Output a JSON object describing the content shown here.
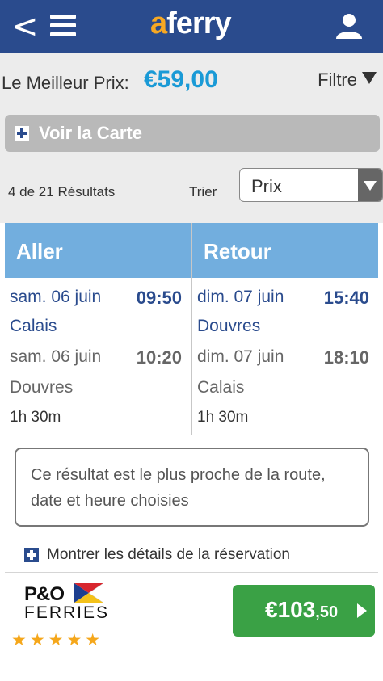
{
  "header": {
    "logo_a": "a",
    "logo_rest": "ferry",
    "back_icon": "chevron-left-icon",
    "menu_icon": "hamburger-icon",
    "user_icon": "user-icon"
  },
  "best_price": {
    "label": "Le Meilleur Prix:",
    "price": "€59,00"
  },
  "filter": {
    "label": "Filtre"
  },
  "map_toggle": {
    "label": "Voir la Carte"
  },
  "results": {
    "count": "4 de 21 Résultats",
    "sort_label": "Trier",
    "sort_value": "Prix"
  },
  "journey": {
    "outbound": {
      "header": "Aller",
      "depart_date": "sam. 06 juin",
      "depart_time": "09:50",
      "depart_port": "Calais",
      "arrive_date": "sam. 06 juin",
      "arrive_time": "10:20",
      "arrive_port": "Douvres",
      "duration": "1h 30m"
    },
    "return": {
      "header": "Retour",
      "depart_date": "dim. 07 juin",
      "depart_time": "15:40",
      "depart_port": "Douvres",
      "arrive_date": "dim. 07 juin",
      "arrive_time": "18:10",
      "arrive_port": "Calais",
      "duration": "1h 30m"
    }
  },
  "note": "Ce résultat est le plus proche de la route, date et heure choisies",
  "details_toggle": "Montrer les détails de la réservation",
  "operator": {
    "name_line1": "P&O",
    "name_line2": "FERRIES",
    "rating": 5,
    "stars": "★★★★★"
  },
  "price_button": {
    "amount": "€103",
    "cents": ",50"
  },
  "colors": {
    "header_bg": "#2a4b8d",
    "logo_accent": "#f7a823",
    "price_blue": "#1a9ad6",
    "column_header": "#72aede",
    "button_green": "#3aa145",
    "star": "#f5a71b"
  }
}
